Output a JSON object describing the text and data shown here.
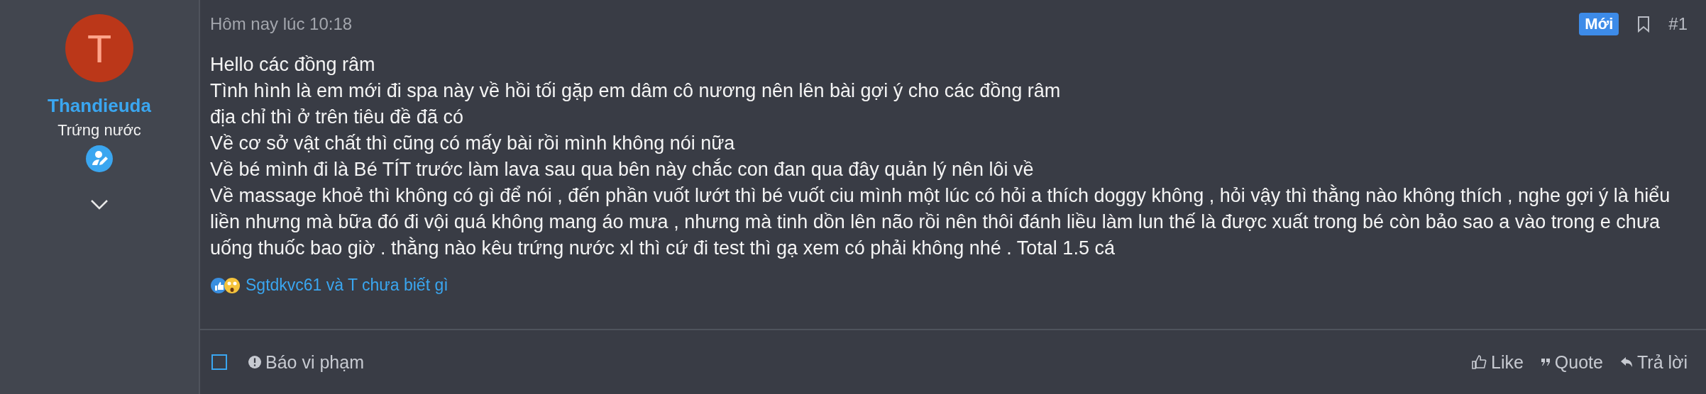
{
  "author": {
    "avatar_letter": "T",
    "name": "Thandieuda",
    "title": "Trứng nước"
  },
  "post": {
    "time": "Hôm nay lúc 10:18",
    "badge": "Mới",
    "number": "#1",
    "lines": [
      "Hello các đồng râm",
      "Tình hình là em mới đi spa này về hồi tối gặp em dâm cô nương nên lên bài gợi ý cho các đồng râm",
      "địa chỉ thì ở trên tiêu đề đã có",
      "Về cơ sở vật chất thì cũng có mấy bài rồi mình không nói nữa",
      "Về bé mình đi là Bé TÍT trước làm lava sau qua bên này chắc con đan qua đây quản lý nên lôi về",
      "Về massage khoẻ thì không có gì để nói , đến phần vuốt lướt thì bé vuốt ciu mình một lúc có hỏi a thích doggy không , hỏi vậy thì thằng nào không thích , nghe gợi ý là hiểu liền nhưng mà bữa đó đi vội quá không mang áo mưa , nhưng mà tinh dồn lên não rồi nên thôi đánh liều làm lun thế là được xuất trong bé còn bảo sao a vào trong e chưa uống thuốc bao giờ . thằng nào kêu trứng nước xl thì cứ đi test thì gạ xem có phải không nhé . Total 1.5 cá"
    ],
    "reactions": "Sgtdkvc61 và T chưa biết gì"
  },
  "footer": {
    "select": {
      "checked": false
    },
    "report": "Báo vi phạm",
    "actions": [
      {
        "kind": "like",
        "label": "Like"
      },
      {
        "kind": "quote",
        "label": "Quote"
      },
      {
        "kind": "reply",
        "label": "Trả lời"
      }
    ]
  }
}
